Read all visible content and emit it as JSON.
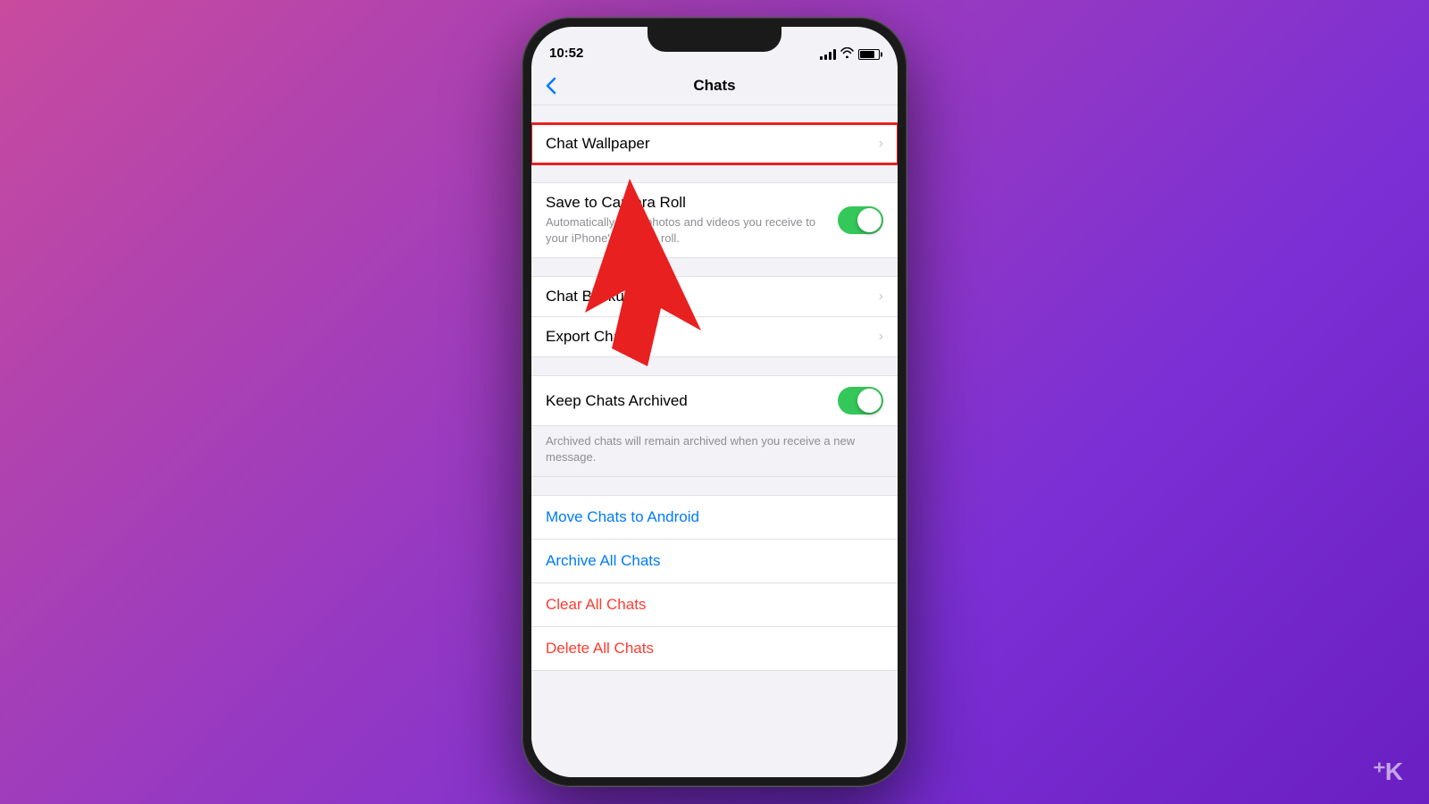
{
  "background": {
    "gradient_start": "#c84b9e",
    "gradient_end": "#6a1fc2"
  },
  "status_bar": {
    "time": "10:52"
  },
  "nav": {
    "back_label": "‹",
    "title": "Chats"
  },
  "sections": {
    "group1": {
      "rows": [
        {
          "id": "chat-wallpaper",
          "label": "Chat Wallpaper",
          "type": "navigation",
          "highlighted": true
        }
      ]
    },
    "group2": {
      "rows": [
        {
          "id": "save-to-camera",
          "label": "Save to Camera Roll",
          "sublabel": "Automatically save photos and videos you receive to your iPhone's camera roll.",
          "type": "toggle",
          "toggle_on": true
        }
      ]
    },
    "group3": {
      "rows": [
        {
          "id": "chat-backup",
          "label": "Chat Backup",
          "type": "navigation"
        },
        {
          "id": "export-chat",
          "label": "Export Chat",
          "type": "navigation"
        }
      ]
    },
    "group4": {
      "rows": [
        {
          "id": "keep-chats-archived",
          "label": "Keep Chats Archived",
          "type": "toggle",
          "toggle_on": true
        }
      ],
      "sublabel": "Archived chats will remain archived when you receive a new message."
    },
    "group5": {
      "rows": [
        {
          "id": "move-chats-android",
          "label": "Move Chats to Android",
          "type": "action",
          "color": "blue"
        },
        {
          "id": "archive-all-chats",
          "label": "Archive All Chats",
          "type": "action",
          "color": "blue"
        },
        {
          "id": "clear-all-chats",
          "label": "Clear All Chats",
          "type": "action",
          "color": "red"
        },
        {
          "id": "delete-all-chats",
          "label": "Delete All Chats",
          "type": "action",
          "color": "red"
        }
      ]
    }
  },
  "watermark": {
    "symbol": "⁺K"
  }
}
